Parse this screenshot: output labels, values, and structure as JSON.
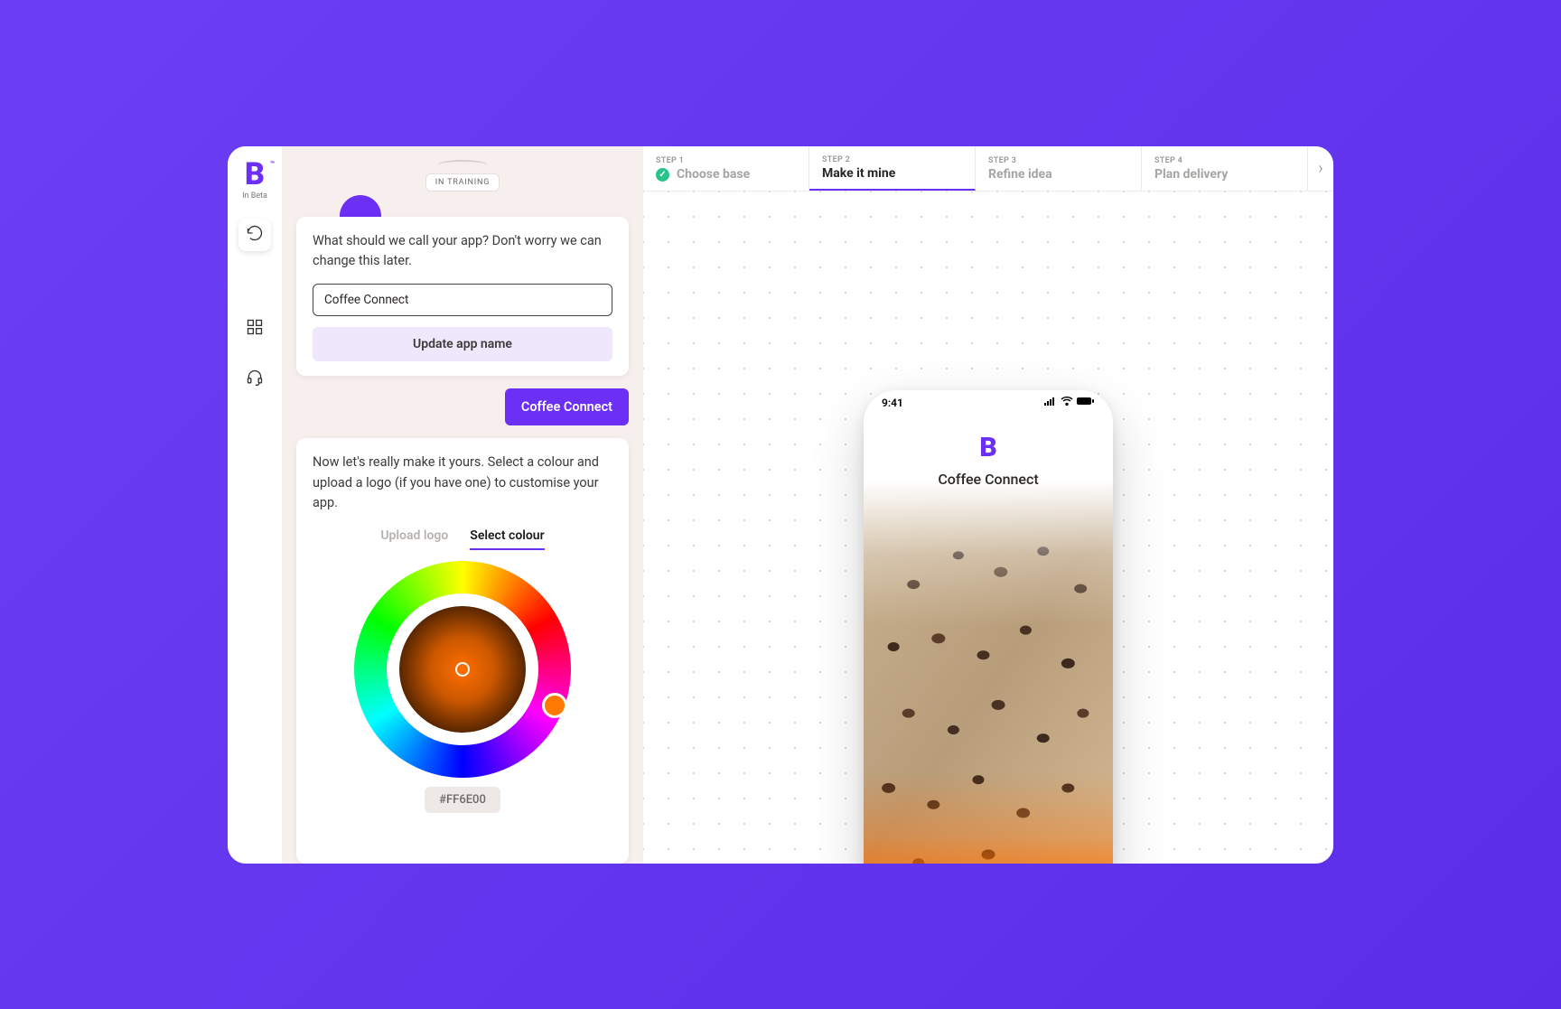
{
  "brand": {
    "logo_text": "B",
    "logo_subtitle": "In Beta"
  },
  "chat": {
    "training_label": "IN TRAINING",
    "prompt1": "What should we call your app? Don't worry we can change this later.",
    "app_name_value": "Coffee Connect",
    "update_button": "Update app name",
    "user_reply": "Coffee Connect",
    "prompt2": "Now let's really make it yours. Select a colour and upload a logo (if you have one) to customise your app.",
    "tab_upload": "Upload logo",
    "tab_colour": "Select colour",
    "hex_value": "#FF6E00"
  },
  "steps": [
    {
      "num": "STEP 1",
      "label": "Choose base",
      "state": "done"
    },
    {
      "num": "STEP 2",
      "label": "Make it mine",
      "state": "active"
    },
    {
      "num": "STEP 3",
      "label": "Refine idea",
      "state": "pending"
    },
    {
      "num": "STEP 4",
      "label": "Plan delivery",
      "state": "pending"
    }
  ],
  "phone": {
    "time": "9:41",
    "app_title": "Coffee Connect",
    "logo_text": "B"
  },
  "colors": {
    "accent": "#6b2ff5",
    "picked": "#FF6E00"
  }
}
